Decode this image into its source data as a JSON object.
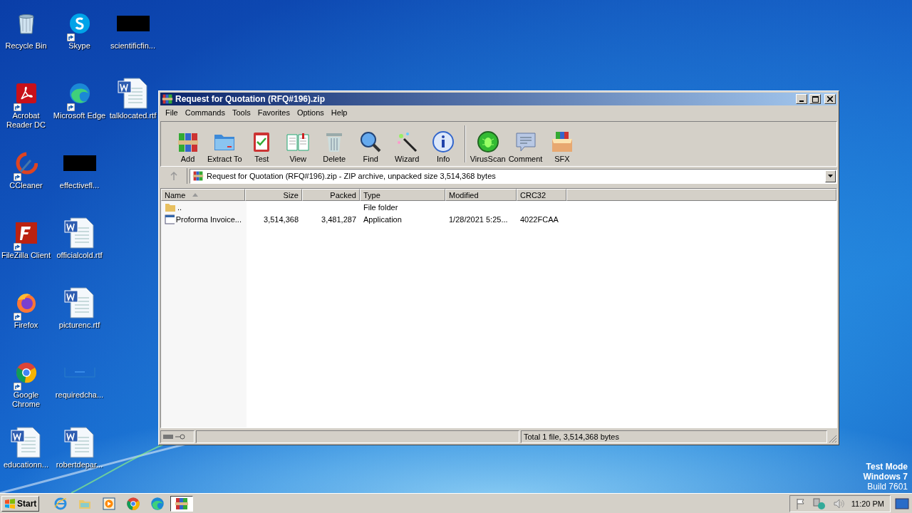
{
  "desktop_icons": [
    {
      "label": "Recycle Bin",
      "shortcut": false
    },
    {
      "label": "Acrobat Reader DC",
      "shortcut": true
    },
    {
      "label": "CCleaner",
      "shortcut": true
    },
    {
      "label": "FileZilla Client",
      "shortcut": true
    },
    {
      "label": "Firefox",
      "shortcut": true
    },
    {
      "label": "Google Chrome",
      "shortcut": true
    },
    {
      "label": "educationn...",
      "shortcut": false
    },
    {
      "label": "Skype",
      "shortcut": true
    },
    {
      "label": "Microsoft Edge",
      "shortcut": true
    },
    {
      "label": "effectivefl...",
      "shortcut": false
    },
    {
      "label": "officialcold.rtf",
      "shortcut": false
    },
    {
      "label": "picturenc.rtf",
      "shortcut": false
    },
    {
      "label": "requiredcha...",
      "shortcut": false
    },
    {
      "label": "robertdepar...",
      "shortcut": false
    },
    {
      "label": "scientificfin...",
      "shortcut": false
    },
    {
      "label": "talklocated.rtf",
      "shortcut": false
    }
  ],
  "window": {
    "title": "Request for Quotation (RFQ#196).zip",
    "menu": [
      "File",
      "Commands",
      "Tools",
      "Favorites",
      "Options",
      "Help"
    ],
    "toolbar": [
      [
        {
          "label": "Add"
        },
        {
          "label": "Extract To"
        },
        {
          "label": "Test"
        },
        {
          "label": "View"
        },
        {
          "label": "Delete"
        },
        {
          "label": "Find"
        },
        {
          "label": "Wizard"
        },
        {
          "label": "Info"
        }
      ],
      [
        {
          "label": "VirusScan"
        },
        {
          "label": "Comment"
        },
        {
          "label": "SFX"
        }
      ]
    ],
    "address": "Request for Quotation (RFQ#196).zip - ZIP archive, unpacked size 3,514,368 bytes",
    "columns": [
      {
        "label": "Name",
        "sorted": true
      },
      {
        "label": "Size",
        "sorted": false
      },
      {
        "label": "Packed",
        "sorted": false
      },
      {
        "label": "Type",
        "sorted": false
      },
      {
        "label": "Modified",
        "sorted": false
      },
      {
        "label": "CRC32",
        "sorted": false
      }
    ],
    "rows": [
      {
        "kind": "folder",
        "cells": [
          "..",
          "",
          "",
          "File folder",
          "",
          ""
        ]
      },
      {
        "kind": "application",
        "cells": [
          "Proforma Invoice...",
          "3,514,368",
          "3,481,287",
          "Application",
          "1/28/2021 5:25...",
          "4022FCAA"
        ]
      }
    ],
    "status": "Total 1 file, 3,514,368 bytes"
  },
  "watermark_text": [
    "Test Mode",
    "Windows 7",
    "Build 7601"
  ],
  "taskbar": {
    "start": "Start",
    "apps": [
      {
        "selected": false
      },
      {
        "selected": false
      },
      {
        "selected": false
      },
      {
        "selected": false
      },
      {
        "selected": false
      },
      {
        "selected": true
      }
    ],
    "clock": "11:20 PM"
  }
}
